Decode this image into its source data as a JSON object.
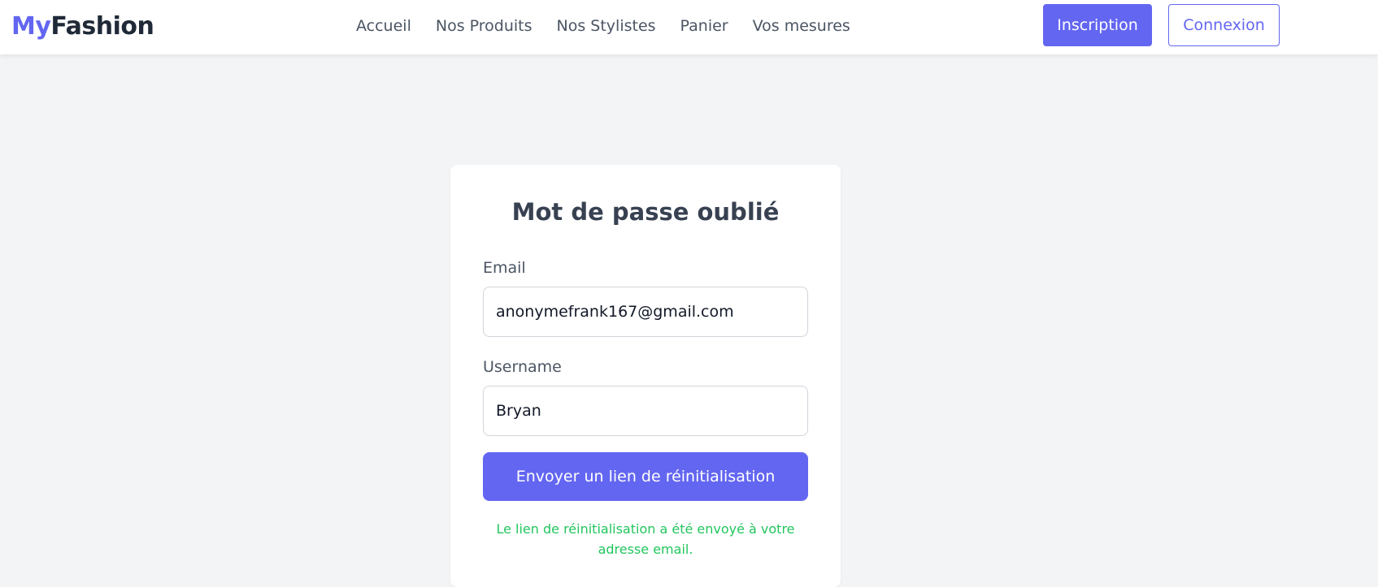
{
  "header": {
    "logo_prefix": "My",
    "logo_suffix": "Fashion",
    "nav": [
      {
        "label": "Accueil"
      },
      {
        "label": "Nos Produits"
      },
      {
        "label": "Nos Stylistes"
      },
      {
        "label": "Panier"
      },
      {
        "label": "Vos mesures"
      }
    ],
    "register_label": "Inscription",
    "login_label": "Connexion"
  },
  "form": {
    "title": "Mot de passe oublié",
    "email_label": "Email",
    "email_value": "anonymefrank167@gmail.com",
    "username_label": "Username",
    "username_value": "Bryan",
    "submit_label": "Envoyer un lien de réinitialisation",
    "success_message": "Le lien de réinitialisation a été envoyé à votre adresse email."
  },
  "colors": {
    "accent": "#6366f1",
    "success": "#22c55e",
    "background": "#f3f4f6"
  }
}
